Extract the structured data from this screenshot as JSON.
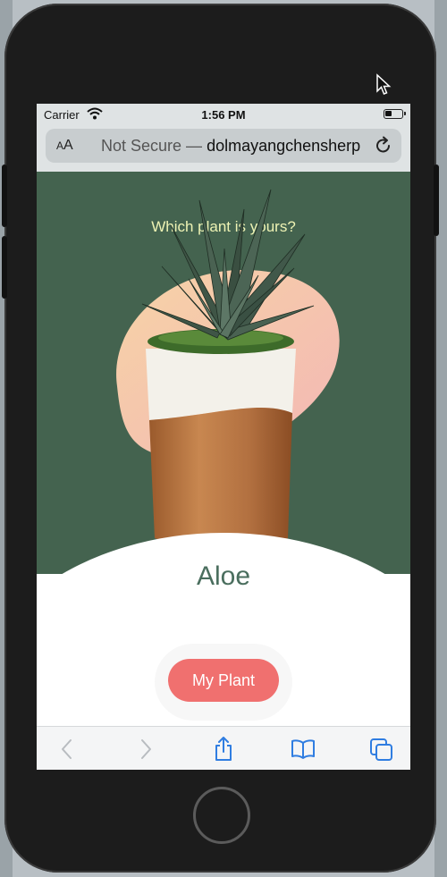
{
  "status_bar": {
    "carrier": "Carrier",
    "time": "1:56 PM"
  },
  "browser": {
    "text_size_label_large": "A",
    "text_size_label_small": "A",
    "url_prefix": "Not Secure —",
    "url_domain": "dolmayangchensherp"
  },
  "page": {
    "question": "Which plant is yours?",
    "plant_name": "Aloe",
    "cta_label": "My Plant"
  },
  "colors": {
    "hero_bg": "#44634f",
    "question_text": "#eef3b4",
    "plant_name_text": "#4a6e5e",
    "cta_bg": "#f0706f",
    "toolbar_icon": "#2f7de1"
  },
  "icons": [
    "wifi-icon",
    "battery-icon",
    "reload-icon",
    "back-icon",
    "forward-icon",
    "share-icon",
    "bookmarks-icon",
    "tabs-icon",
    "cursor-icon"
  ]
}
